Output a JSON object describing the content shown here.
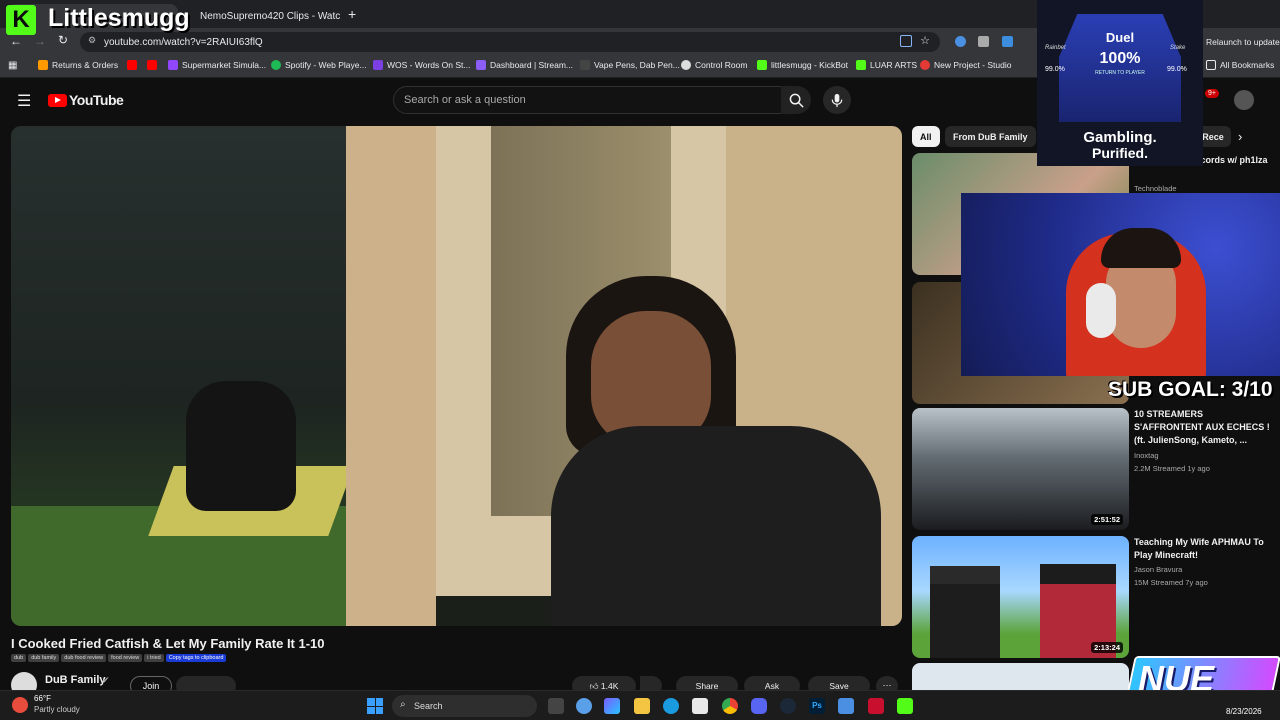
{
  "overlay": {
    "kick_letter": "K",
    "streamer_name": "Littlesmugg",
    "sub_goal": "SUB GOAL: 3/10",
    "brand": "NUE"
  },
  "tabs": [
    {
      "title": "Littlesmugg"
    },
    {
      "title": "NemoSupremo420 Clips - Watc"
    }
  ],
  "address": {
    "url": "youtube.com/watch?v=2RAIUI63flQ",
    "update_label": "Relaunch to update"
  },
  "bookmarks": [
    {
      "label": "Returns & Orders",
      "color": "#ff9900"
    },
    {
      "label": "Supermarket Simula...",
      "color": "#9146ff"
    },
    {
      "label": "Spotify - Web Playe...",
      "color": "#1db954"
    },
    {
      "label": "WOS - Words On St...",
      "color": "#7b3fe4"
    },
    {
      "label": "Dashboard | Stream...",
      "color": "#8b5cf6"
    },
    {
      "label": "Vape Pens, Dab Pen...",
      "color": "#444444"
    },
    {
      "label": "Control Room",
      "color": "#dddddd"
    },
    {
      "label": "littlesmugg - KickBot",
      "color": "#53fc18"
    },
    {
      "label": "LUAR ARTS",
      "color": "#53fc18"
    },
    {
      "label": "New Project - Studio",
      "color": "#e53935"
    }
  ],
  "bookmarks_all": "All Bookmarks",
  "youtube": {
    "logo_text": "YouTube",
    "search_placeholder": "Search or ask a question",
    "notif_badge": "9+"
  },
  "video": {
    "title": "I Cooked Fried Catfish & Let My Family Rate It 1-10",
    "tags": [
      "dub",
      "dub family",
      "dub food review",
      "food review",
      "i tried"
    ],
    "copy_tags": "Copy tags to clipboard",
    "channel": "DuB Family",
    "join_label": "Join",
    "likes": "1.4K",
    "share_label": "Share",
    "ask_label": "Ask",
    "save_label": "Save"
  },
  "chips": [
    {
      "label": "All",
      "active": true
    },
    {
      "label": "From DuB Family",
      "active": false
    },
    {
      "label": "Rece",
      "active": false
    }
  ],
  "recommended": [
    {
      "title": "...aft monday records w/ ph1lza",
      "channel": "Technoblade",
      "meta": "",
      "duration": ""
    },
    {
      "title": "",
      "channel": "",
      "meta": "",
      "duration": ""
    },
    {
      "title": "10 STREAMERS S'AFFRONTENT AUX ECHECS ! (ft. JulienSong, Kameto, ...",
      "channel": "Inoxtag",
      "meta": "2.2M  Streamed 1y ago",
      "duration": "2:51:52"
    },
    {
      "title": "Teaching My Wife APHMAU To Play Minecraft!",
      "channel": "Jason Bravura",
      "meta": "15M  Streamed 7y ago",
      "duration": "2:13:24"
    }
  ],
  "ad": {
    "brand_left": "Rainbet",
    "brand_right": "Stake",
    "pct_left": "99.0%",
    "pct_right": "99.0%",
    "headline": "Duel",
    "big": "100%",
    "sub": "RETURN TO PLAYER",
    "tagline1": "Gambling.",
    "tagline2": "Purified."
  },
  "taskbar": {
    "temp": "66°F",
    "weather": "Partly cloudy",
    "search": "Search",
    "date": "8/23/2026"
  }
}
